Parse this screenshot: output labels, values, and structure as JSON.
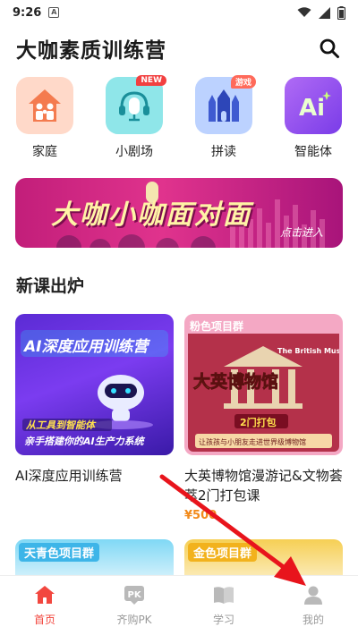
{
  "status_bar": {
    "time": "9:26",
    "notification_icon": "A"
  },
  "header": {
    "title": "大咖素质训练营"
  },
  "features": [
    {
      "label": "家庭",
      "icon": "family-house-icon",
      "color": "#ffd9c9",
      "badge": ""
    },
    {
      "label": "小剧场",
      "icon": "headset-mic-icon",
      "color": "#8fe6e9",
      "badge": "NEW"
    },
    {
      "label": "拼读",
      "icon": "castle-icon",
      "color": "#bcd2ff",
      "badge": "游戏"
    },
    {
      "label": "智能体",
      "icon": "ai-icon",
      "color": "#9a5ef0",
      "badge": ""
    }
  ],
  "banner": {
    "title": "大咖小咖面对面",
    "enter": "点击进入"
  },
  "section": {
    "title": "新课出炉"
  },
  "courses": [
    {
      "name": "AI深度应用训练营",
      "price": "",
      "image_title": "AI深度应用训练营",
      "image_line1": "从工具到智能体",
      "image_line2": "亲手搭建你的AI生产力系统"
    },
    {
      "name": "大英博物馆漫游记&文物荟萃2门打包课",
      "price": "¥500",
      "image_tag": "粉色项目群",
      "image_title": "大英博物馆",
      "image_sub": "The British Museum",
      "image_note": "2门打包",
      "image_foot": "让孩孩与小朋友走进世界级博物馆"
    }
  ],
  "more_courses": [
    {
      "tag": "天青色项目群",
      "color": "#3db5e8"
    },
    {
      "tag": "金色项目群",
      "color": "#f2b21d"
    }
  ],
  "tabbar": {
    "items": [
      {
        "label": "首页",
        "active": true
      },
      {
        "label": "齐购PK",
        "active": false
      },
      {
        "label": "学习",
        "active": false
      },
      {
        "label": "我的",
        "active": false
      }
    ]
  },
  "colors": {
    "accent": "#f2473f",
    "arrow": "#e8141c",
    "price": "#f28a1a"
  }
}
